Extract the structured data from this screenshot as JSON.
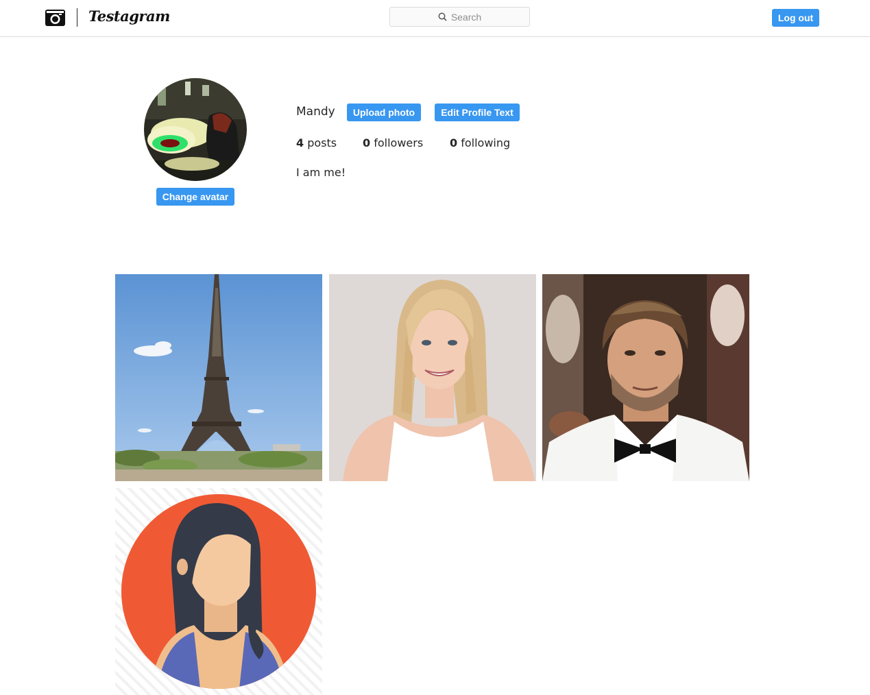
{
  "header": {
    "brand": "Testagram",
    "search_placeholder": "Search",
    "logout_label": "Log out"
  },
  "profile": {
    "username": "Mandy",
    "upload_label": "Upload photo",
    "edit_label": "Edit Profile Text",
    "change_avatar_label": "Change avatar",
    "posts_count": "4",
    "posts_label": "posts",
    "followers_count": "0",
    "followers_label": "followers",
    "following_count": "0",
    "following_label": "following",
    "bio": "I am me!"
  },
  "colors": {
    "accent": "#3897f0",
    "border": "#dbdbdb"
  },
  "posts": [
    {
      "icon": "eiffel-tower-photo"
    },
    {
      "icon": "blonde-woman-portrait-photo"
    },
    {
      "icon": "man-in-tuxedo-photo"
    },
    {
      "icon": "woman-avatar-illustration"
    }
  ]
}
